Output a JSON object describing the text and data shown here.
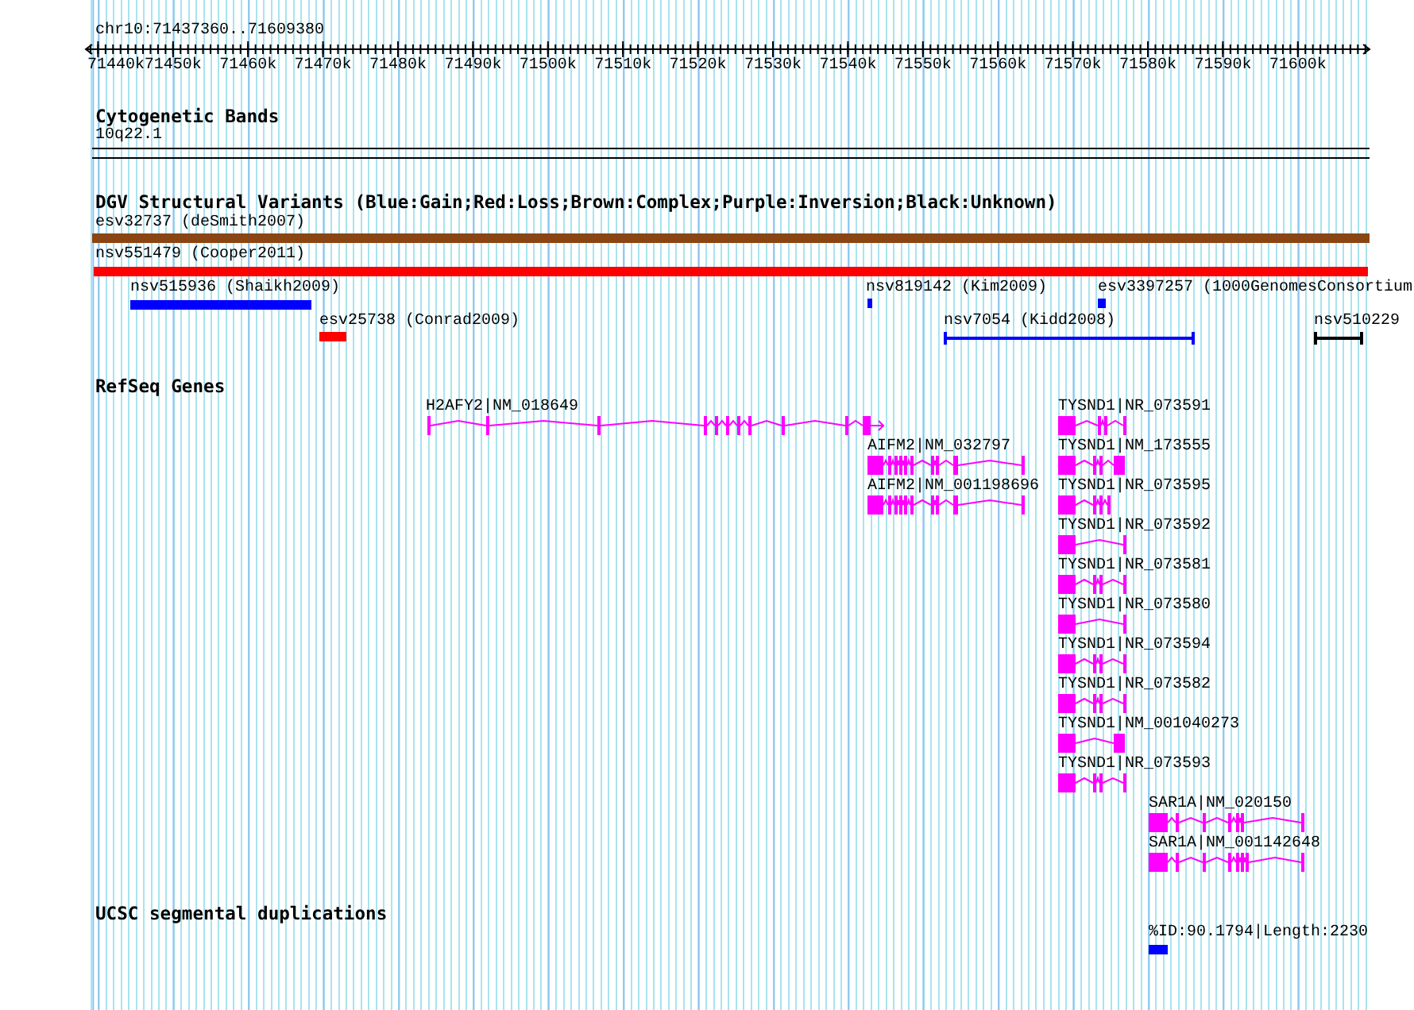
{
  "location": "chr10:71437360..71609380",
  "ruler_ticks": [
    "71440k",
    "71450k",
    "71460k",
    "71470k",
    "71480k",
    "71490k",
    "71500k",
    "71510k",
    "71520k",
    "71530k",
    "71540k",
    "71550k",
    "71560k",
    "71570k",
    "71580k",
    "71590k",
    "71600k"
  ],
  "cytogenetic_bands": {
    "title": "Cytogenetic Bands",
    "band": "10q22.1"
  },
  "dgv": {
    "title": "DGV Structural Variants (Blue:Gain;Red:Loss;Brown:Complex;Purple:Inversion;Black:Unknown)",
    "variants": [
      {
        "label": "esv32737 (deSmith2007)",
        "color": "#8b4513",
        "kind": "bar"
      },
      {
        "label": "nsv551479 (Cooper2011)",
        "color": "#ff0000",
        "kind": "bar"
      },
      {
        "label": "nsv515936 (Shaikh2009)",
        "color": "#0000ff",
        "kind": "bar"
      },
      {
        "label": "nsv819142 (Kim2009)",
        "color": "#0000ff",
        "kind": "bar"
      },
      {
        "label": "esv3397257 (1000GenomesConsortium",
        "color": "#0000ff",
        "kind": "bar"
      },
      {
        "label": "esv25738 (Conrad2009)",
        "color": "#ff0000",
        "kind": "bar"
      },
      {
        "label": "nsv7054 (Kidd2008)",
        "color": "#0000ff",
        "kind": "span"
      },
      {
        "label": "nsv510229",
        "color": "#000000",
        "kind": "span"
      }
    ]
  },
  "refseq": {
    "title": "RefSeq Genes",
    "genes": [
      {
        "label": "H2AFY2|NM_018649"
      },
      {
        "label": "AIFM2|NM_032797"
      },
      {
        "label": "AIFM2|NM_001198696"
      },
      {
        "label": "TYSND1|NR_073591"
      },
      {
        "label": "TYSND1|NM_173555"
      },
      {
        "label": "TYSND1|NR_073595"
      },
      {
        "label": "TYSND1|NR_073592"
      },
      {
        "label": "TYSND1|NR_073581"
      },
      {
        "label": "TYSND1|NR_073580"
      },
      {
        "label": "TYSND1|NR_073594"
      },
      {
        "label": "TYSND1|NR_073582"
      },
      {
        "label": "TYSND1|NM_001040273"
      },
      {
        "label": "TYSND1|NR_073593"
      },
      {
        "label": "SAR1A|NM_020150"
      },
      {
        "label": "SAR1A|NM_001142648"
      }
    ]
  },
  "segdups": {
    "title": "UCSC segmental duplications",
    "features": [
      {
        "label": "%ID:90.1794|Length:2230"
      }
    ]
  }
}
